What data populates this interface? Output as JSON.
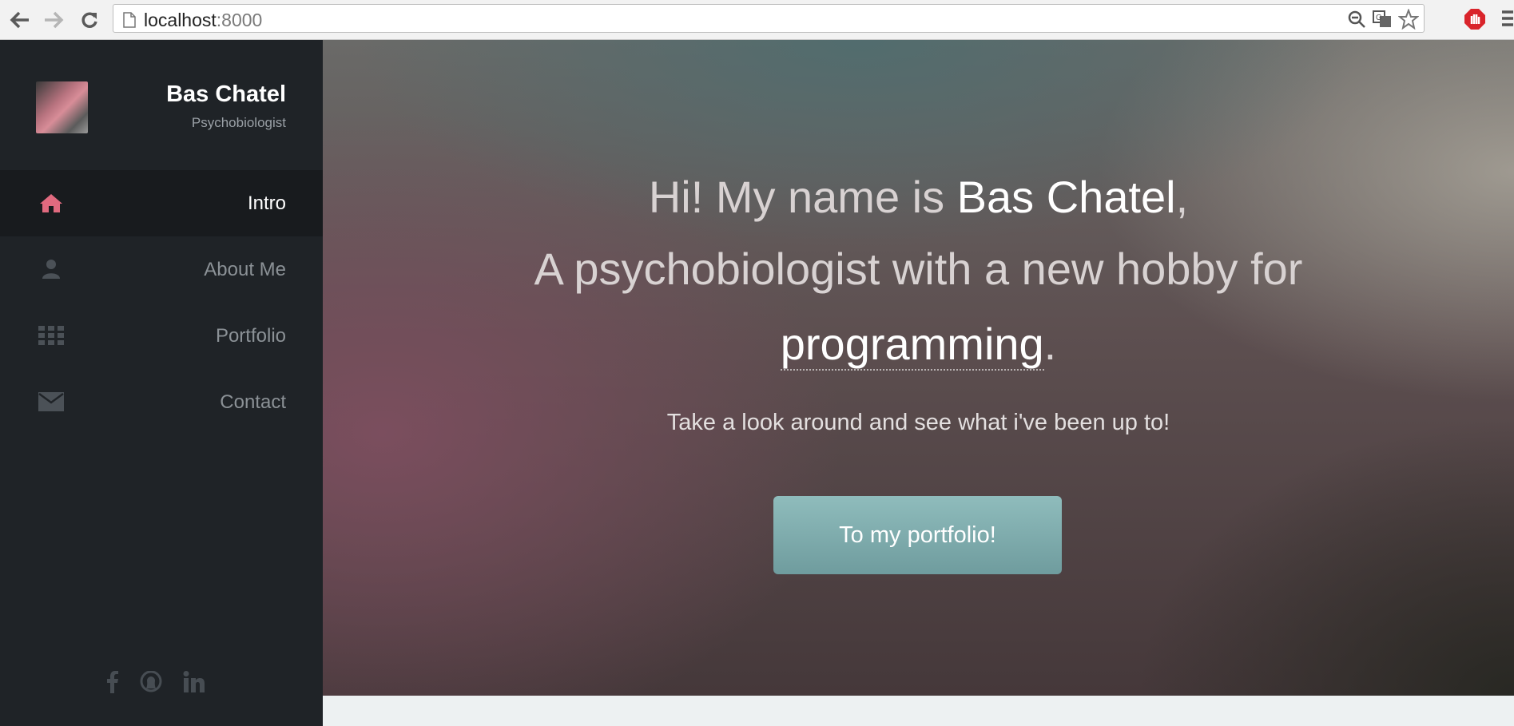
{
  "browser": {
    "url_host": "localhost",
    "url_port": ":8000",
    "icons": [
      "back-arrow-icon",
      "forward-arrow-icon",
      "reload-icon",
      "page-icon",
      "zoom-icon",
      "translate-icon",
      "star-icon",
      "adblock-icon",
      "menu-icon"
    ]
  },
  "sidebar": {
    "name": "Bas Chatel",
    "role": "Psychobiologist",
    "items": [
      {
        "label": "Intro",
        "icon": "home-icon",
        "active": true
      },
      {
        "label": "About Me",
        "icon": "user-icon",
        "active": false
      },
      {
        "label": "Portfolio",
        "icon": "grid-icon",
        "active": false
      },
      {
        "label": "Contact",
        "icon": "envelope-icon",
        "active": false
      }
    ],
    "social": [
      "facebook-icon",
      "github-icon",
      "linkedin-icon"
    ]
  },
  "hero": {
    "line1_prefix": "Hi! My name is ",
    "line1_name": "Bas Chatel",
    "line1_suffix": ",",
    "line2": "A psychobiologist with a new hobby for",
    "line3_word": "programming",
    "line3_suffix": ".",
    "tagline": "Take a look around and see what i've been up to!",
    "cta_label": "To my portfolio!"
  },
  "colors": {
    "sidebar_bg": "#1f2327",
    "active_icon": "#e06a7f",
    "cta_bg": "#7fadad"
  }
}
